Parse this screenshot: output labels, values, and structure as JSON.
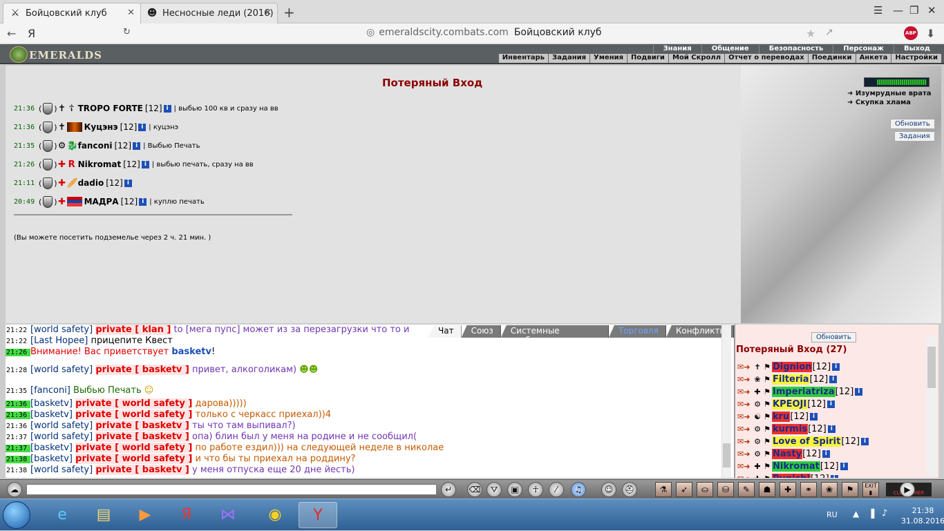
{
  "browser": {
    "tabs": [
      {
        "title": "Бойцовский клуб",
        "active": true
      },
      {
        "title": "Несносные леди (2016)",
        "active": false
      }
    ],
    "back_label": "←",
    "yandex_logo": "Я",
    "url_host": "emeraldscity.combats.com",
    "url_title": "Бойцовский клуб",
    "abp_label": "ABP"
  },
  "game": {
    "logo_text": "EMERALDS",
    "top_nav": [
      "Знания",
      "Общение",
      "Безопасность",
      "Персонаж",
      "Выход"
    ],
    "sub_nav": [
      "Инвентарь",
      "Задания",
      "Умения",
      "Подвиги",
      "Мой Скролл",
      "Отчет о переводах",
      "Поединки",
      "Анкета",
      "Настройки"
    ],
    "page_title": "Потеряный Вход",
    "side_links": [
      "Изумрудные врата",
      "Скупка хлама"
    ],
    "refresh_label": "Обновить",
    "quests_label": "Задания",
    "dungeon_note": "(Вы можете посетить подземелье через 2 ч. 21 мин. )",
    "groups": [
      {
        "time": "21:36",
        "nick": "TROPO FORTE",
        "level": "[12]",
        "note": "| выбью 100 кв и сразу на вв"
      },
      {
        "time": "21:36",
        "nick": "Куцэнэ",
        "level": "[12]",
        "note": "| куцэнэ"
      },
      {
        "time": "21:35",
        "nick": "fanconi",
        "level": "[12]",
        "note": "| Выбью Печать"
      },
      {
        "time": "21:26",
        "nick": "Nikromat",
        "level": "[12]",
        "note": "| выбью печать, сразу на вв"
      },
      {
        "time": "21:11",
        "nick": "dadio",
        "level": "[12]",
        "note": ""
      },
      {
        "time": "20:49",
        "nick": "МАДРА",
        "level": "[12]",
        "note": "| куплю печать"
      }
    ]
  },
  "chat": {
    "tabs": [
      "Чат",
      "Союз",
      "Системные сообщения",
      "Торговля",
      "Конфликты"
    ],
    "lines": [
      {
        "time": "21:22",
        "hl": false,
        "from": "[world safety]",
        "priv": "private [ klan ]",
        "text": "to [мега пупс] может из за перезагрузки что то и",
        "cls": "m1"
      },
      {
        "time": "21:22",
        "hl": false,
        "from": "[Last Hopee]",
        "priv": "",
        "text": "прицепите Квест",
        "cls": ""
      },
      {
        "time": "21:26",
        "hl": true,
        "from": "",
        "priv": "",
        "text": "Внимание! Вас приветствует",
        "cls": "sys",
        "you": "basketv",
        "tail": "!"
      },
      {
        "time": "21:28",
        "hl": false,
        "from": "[world safety]",
        "priv": "private [ basketv ]",
        "text": "привет, алкоголикам)",
        "cls": "m1"
      },
      {
        "time": "21:35",
        "hl": false,
        "from": "[fanconi]",
        "priv": "",
        "text": "Выбью Печать",
        "cls": "m3"
      },
      {
        "time": "21:36",
        "hl": true,
        "from": "[basketv]",
        "priv": "private [ world safety ]",
        "text": "дарова)))))",
        "cls": "m2"
      },
      {
        "time": "21:36",
        "hl": true,
        "from": "[basketv]",
        "priv": "private [ world safety ]",
        "text": "только с черкасс приехал))4",
        "cls": "m2"
      },
      {
        "time": "21:36",
        "hl": false,
        "from": "[world safety]",
        "priv": "private [ basketv ]",
        "text": "ты что там выпивал?)",
        "cls": "m1"
      },
      {
        "time": "21:37",
        "hl": false,
        "from": "[world safety]",
        "priv": "private [ basketv ]",
        "text": "опа) блин был у меня на родине и не сообщил(",
        "cls": "m1"
      },
      {
        "time": "21:37",
        "hl": true,
        "from": "[basketv]",
        "priv": "private [ world safety ]",
        "text": "по работе ездил))) на следующей неделе в николае",
        "cls": "m2"
      },
      {
        "time": "21:38",
        "hl": true,
        "from": "[basketv]",
        "priv": "private [ world safety ]",
        "text": "и что бы ты приехал на роддину?",
        "cls": "m2"
      },
      {
        "time": "21:38",
        "hl": false,
        "from": "[world safety]",
        "priv": "private [ basketv ]",
        "text": "у меня отпуска еще 20 дне йесть)",
        "cls": "m1"
      }
    ]
  },
  "players": {
    "refresh_label": "Обновить",
    "header": "Потеряный Вход (27)",
    "list": [
      {
        "nick": "Dignion",
        "level": "[12]",
        "bg": "#e83030",
        "fg": "#1a2a8a"
      },
      {
        "nick": "Filteria",
        "level": "[12]",
        "bg": "#f5f53a",
        "fg": "#1a2a8a"
      },
      {
        "nick": "Imperiatriza",
        "level": "[12]",
        "bg": "#2ecc40",
        "fg": "#1a2a8a"
      },
      {
        "nick": "KPEOJI",
        "level": "[12]",
        "bg": "#f5f53a",
        "fg": "#1a2a8a"
      },
      {
        "nick": "kru",
        "level": "[12]",
        "bg": "#e83030",
        "fg": "#1a2a8a"
      },
      {
        "nick": "kurmis",
        "level": "[12]",
        "bg": "#e83030",
        "fg": "#1a2a8a"
      },
      {
        "nick": "Love of Spirit",
        "level": "[12]",
        "bg": "#f5f53a",
        "fg": "#1a2a8a"
      },
      {
        "nick": "Nasty",
        "level": "[12]",
        "bg": "#e83030",
        "fg": "#1a2a8a"
      },
      {
        "nick": "Nikromat",
        "level": "[12]",
        "bg": "#2ecc40",
        "fg": "#1a2a8a"
      },
      {
        "nick": "Pugichi",
        "level": "[12]",
        "bg": "#e83030",
        "fg": "#1a2a8a"
      }
    ]
  },
  "gamebar": {
    "exit_label": "EXIT",
    "clock_label": "CLOCKTIMER"
  },
  "taskbar": {
    "lang": "RU",
    "time": "21:38",
    "date": "31.08.2016"
  }
}
